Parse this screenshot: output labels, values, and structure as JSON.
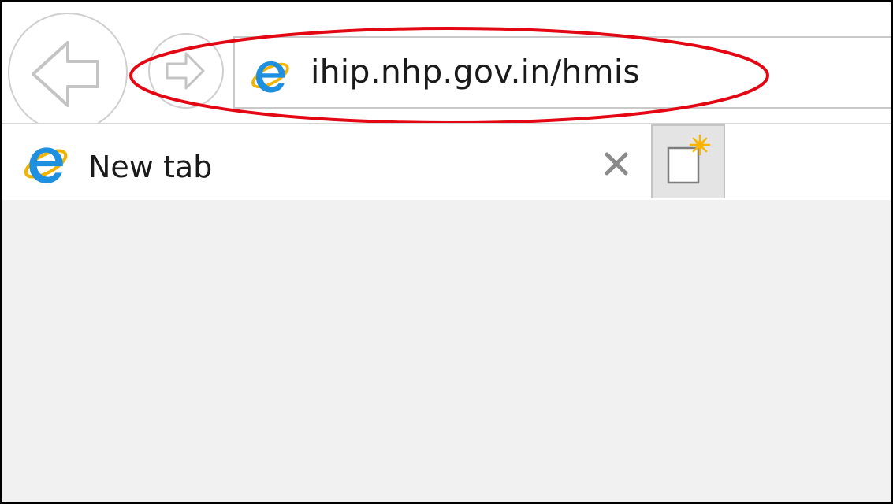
{
  "browser": {
    "address_bar": {
      "url": "ihip.nhp.gov.in/hmis",
      "site_icon": "internet-explorer-icon",
      "highlight_color": "#e30613"
    },
    "navigation": {
      "back_icon": "arrow-left-icon",
      "forward_icon": "arrow-right-icon"
    },
    "tabs": [
      {
        "title": "New tab",
        "icon": "internet-explorer-icon",
        "close_icon": "close-icon"
      }
    ],
    "new_tab_icon": "new-tab-icon"
  },
  "colors": {
    "ie_blue": "#1f8fe0",
    "ie_ring": "#f2b400",
    "content_background": "#f1f1f1"
  }
}
